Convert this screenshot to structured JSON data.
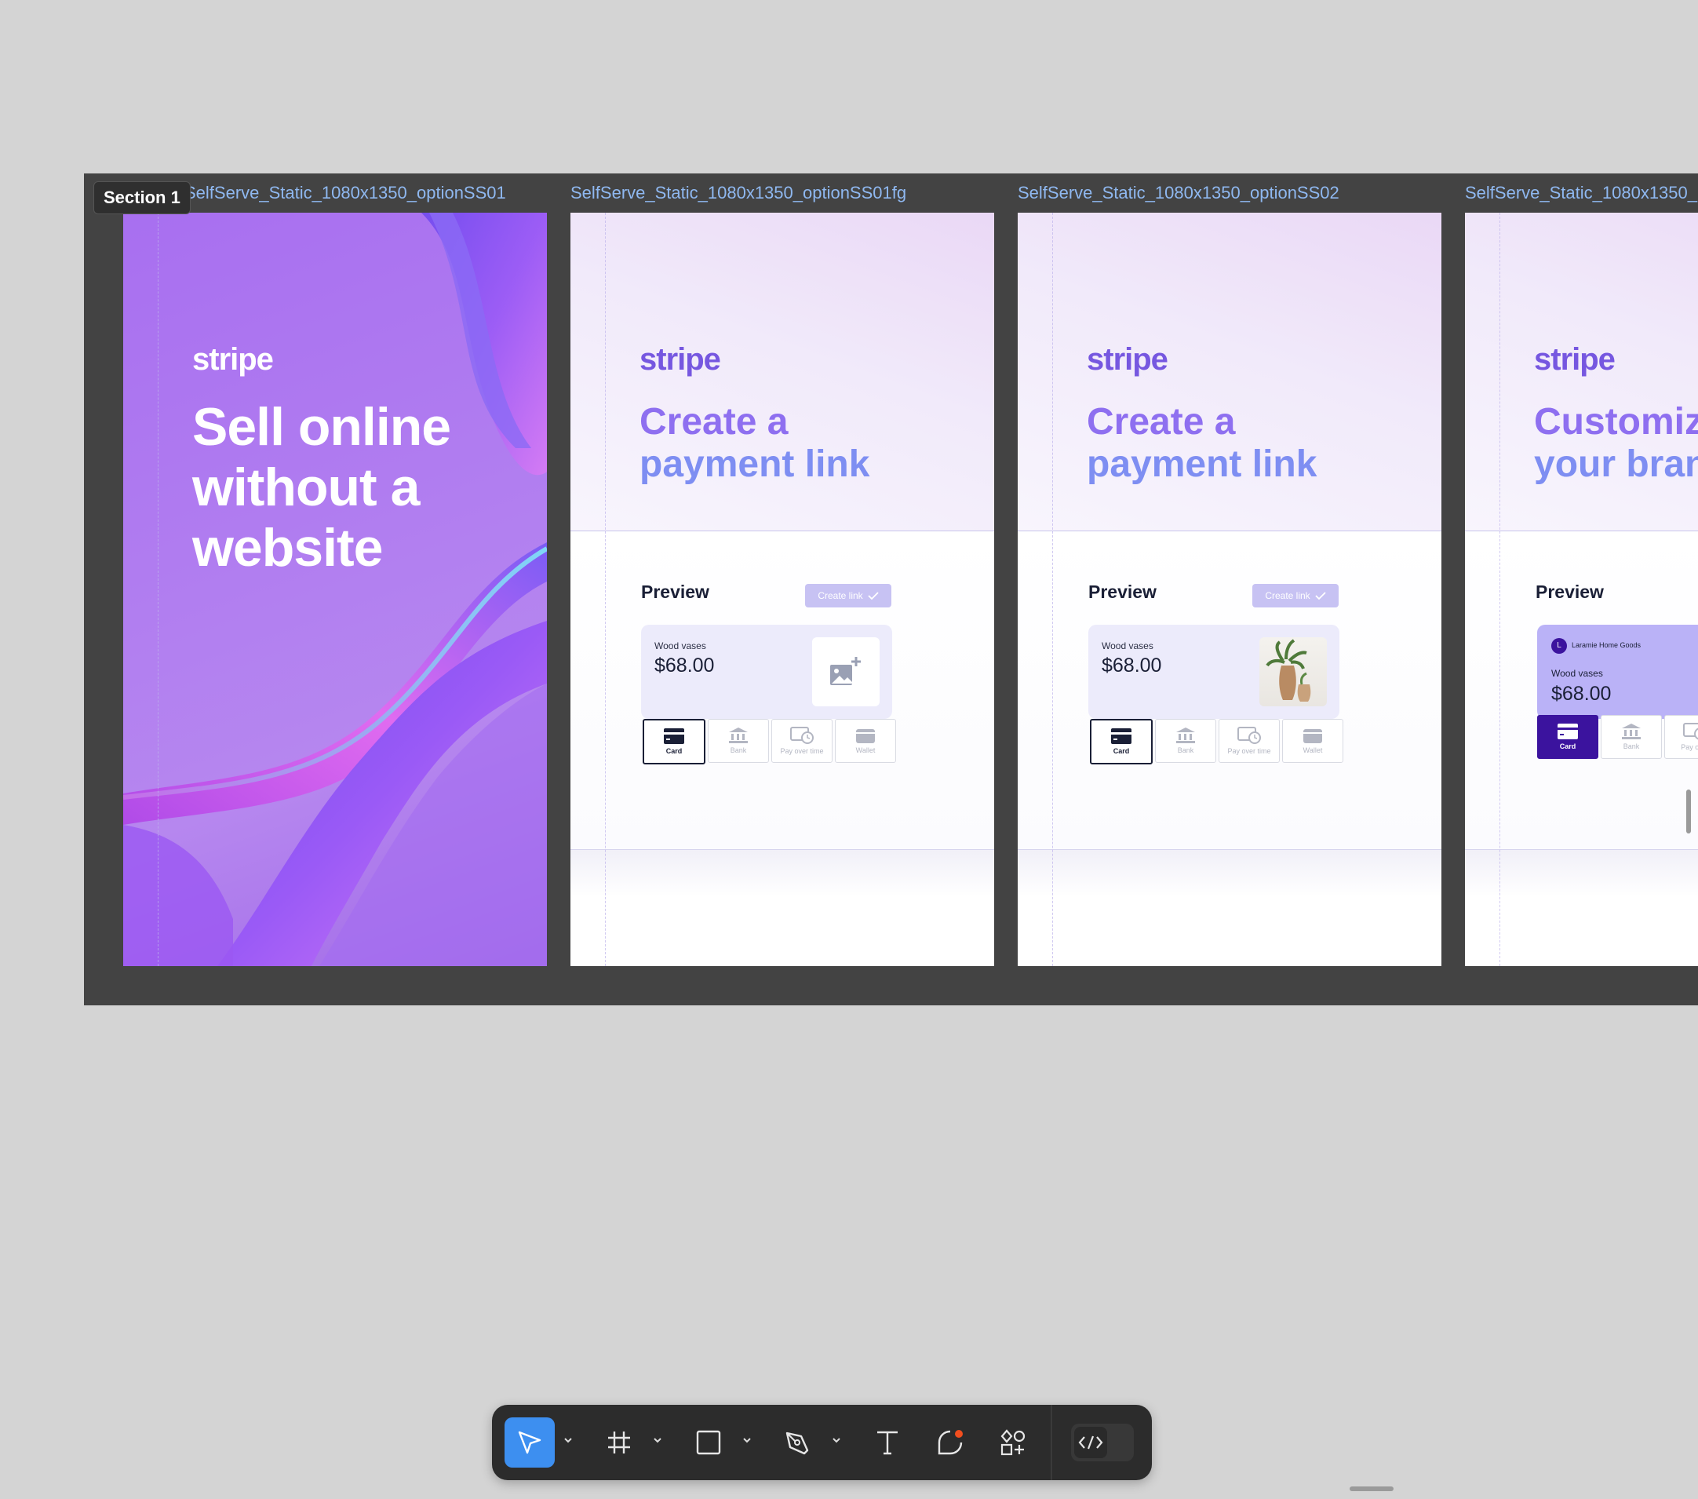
{
  "section": {
    "label": "Section 1"
  },
  "frames": [
    {
      "title": "SelfServe_Static_1080x1350_optionSS01",
      "wordmark": "stripe",
      "headline": "Sell online without a website"
    },
    {
      "title": "SelfServe_Static_1080x1350_optionSS01fg",
      "wordmark": "stripe",
      "headline_line1": "Create a",
      "headline_line2": "payment link",
      "preview_label": "Preview",
      "create_button": "Create link",
      "product_name": "Wood vases",
      "price": "$68.00",
      "methods": [
        "Card",
        "Bank",
        "Pay over time",
        "Wallet"
      ]
    },
    {
      "title": "SelfServe_Static_1080x1350_optionSS02",
      "wordmark": "stripe",
      "headline_line1": "Create a",
      "headline_line2": "payment link",
      "preview_label": "Preview",
      "create_button": "Create link",
      "product_name": "Wood vases",
      "price": "$68.00",
      "methods": [
        "Card",
        "Bank",
        "Pay over time",
        "Wallet"
      ]
    },
    {
      "title": "SelfServe_Static_1080x1350_",
      "wordmark": "stripe",
      "headline_line1": "Customize",
      "headline_line2": "your brand",
      "preview_label": "Preview",
      "store_initial": "L",
      "store_name": "Laramie Home Goods",
      "product_name": "Wood vases",
      "price": "$68.00",
      "methods": [
        "Card",
        "Bank",
        "Pay over"
      ]
    }
  ],
  "toolbar": {
    "tools": [
      "move-tool",
      "frame-tool",
      "shape-tool",
      "pen-tool",
      "text-tool",
      "comment-tool",
      "components-tool"
    ],
    "active_tool": "move-tool",
    "accent": "#3d8ff0"
  },
  "colors": {
    "stripe_purple": "#7657e0",
    "canvas_bg": "#d4d4d4",
    "section_bg": "#434343"
  }
}
